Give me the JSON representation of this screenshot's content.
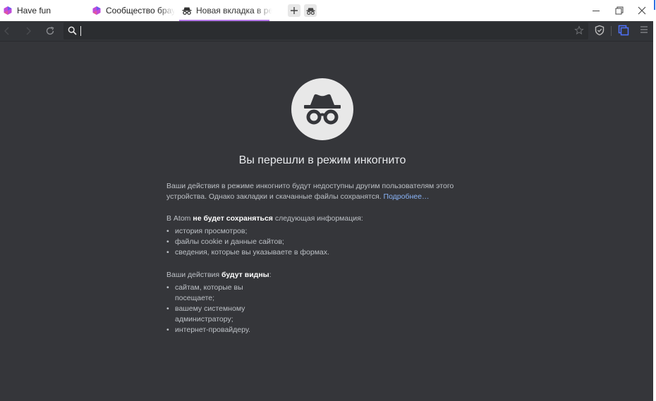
{
  "tabs": [
    {
      "label": "Have fun",
      "icon": "atom-logo-icon"
    },
    {
      "label": "Сообщество браузера",
      "icon": "atom-logo-icon"
    },
    {
      "label": "Новая вкладка в режи",
      "icon": "incognito-icon",
      "active": true
    }
  ],
  "toolbar": {
    "address_value": ""
  },
  "page": {
    "title": "Вы перешли в режим инкогнито",
    "intro": "Ваши действия в режиме инкогнито будут недоступны другим пользователям этого устройства. Однако закладки и скачанные файлы сохранятся.",
    "learn_more": "Подробнее…",
    "not_saved_prefix": "В Atom",
    "not_saved_bold": "не будет сохраняться",
    "not_saved_suffix": "следующая информация:",
    "not_saved_items": [
      "история просмотров;",
      "файлы cookie и данные сайтов;",
      "сведения, которые вы указываете в формах."
    ],
    "visible_prefix": "Ваши действия",
    "visible_bold": "будут видны",
    "visible_suffix": ":",
    "visible_items": [
      "сайтам, которые вы посещаете;",
      "вашему системному администратору;",
      "интернет-провайдеру."
    ]
  },
  "colors": {
    "page_bg": "#35363a",
    "toolbar_bg": "#323438",
    "link": "#8ab4f8",
    "tab_active_accent": "#b478e8"
  }
}
